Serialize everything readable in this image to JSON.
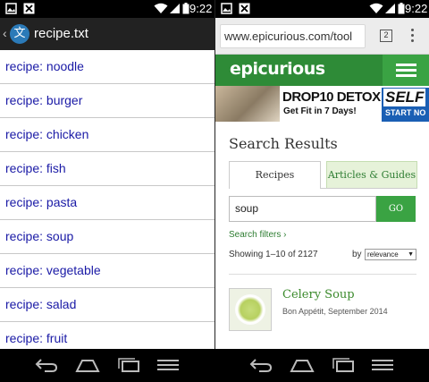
{
  "status": {
    "time": "9:22"
  },
  "left": {
    "app_icon_glyph": "文",
    "title": "recipe.txt",
    "items": [
      "recipe: noodle",
      "recipe: burger",
      "recipe: chicken",
      "recipe: fish",
      "recipe: pasta",
      "recipe: soup",
      "recipe: vegetable",
      "recipe: salad",
      "recipe: fruit"
    ]
  },
  "right": {
    "url": "www.epicurious.com/tool",
    "tab_count": "2",
    "logo": "epicurious",
    "ad": {
      "headline": "DROP10 DETOX",
      "subline": "Get Fit in 7 Days!",
      "brand": "SELF",
      "cta": "START NO"
    },
    "results_title": "Search Results",
    "tabs": {
      "recipes": "Recipes",
      "articles": "Articles & Guides"
    },
    "search_value": "soup",
    "go_label": "GO",
    "search_filters": "Search filters ›",
    "showing": "Showing 1–10 of 2127",
    "sort_by_label": "by",
    "sort_value": "relevance",
    "result": {
      "title": "Celery Soup",
      "subtitle": "Bon Appétit, September 2014"
    }
  },
  "icons": {
    "left_status": [
      "image-icon",
      "close-box-icon"
    ],
    "right_status": [
      "image-icon",
      "close-box-icon"
    ],
    "status_right": [
      "wifi-icon",
      "signal-icon",
      "battery-icon"
    ],
    "nav": [
      "back-icon",
      "home-icon",
      "recent-apps-icon",
      "menu-icon"
    ]
  },
  "colors": {
    "link_blue": "#1a1aa6",
    "epicurious_green": "#2e8b37",
    "accent_green": "#3aa343"
  }
}
